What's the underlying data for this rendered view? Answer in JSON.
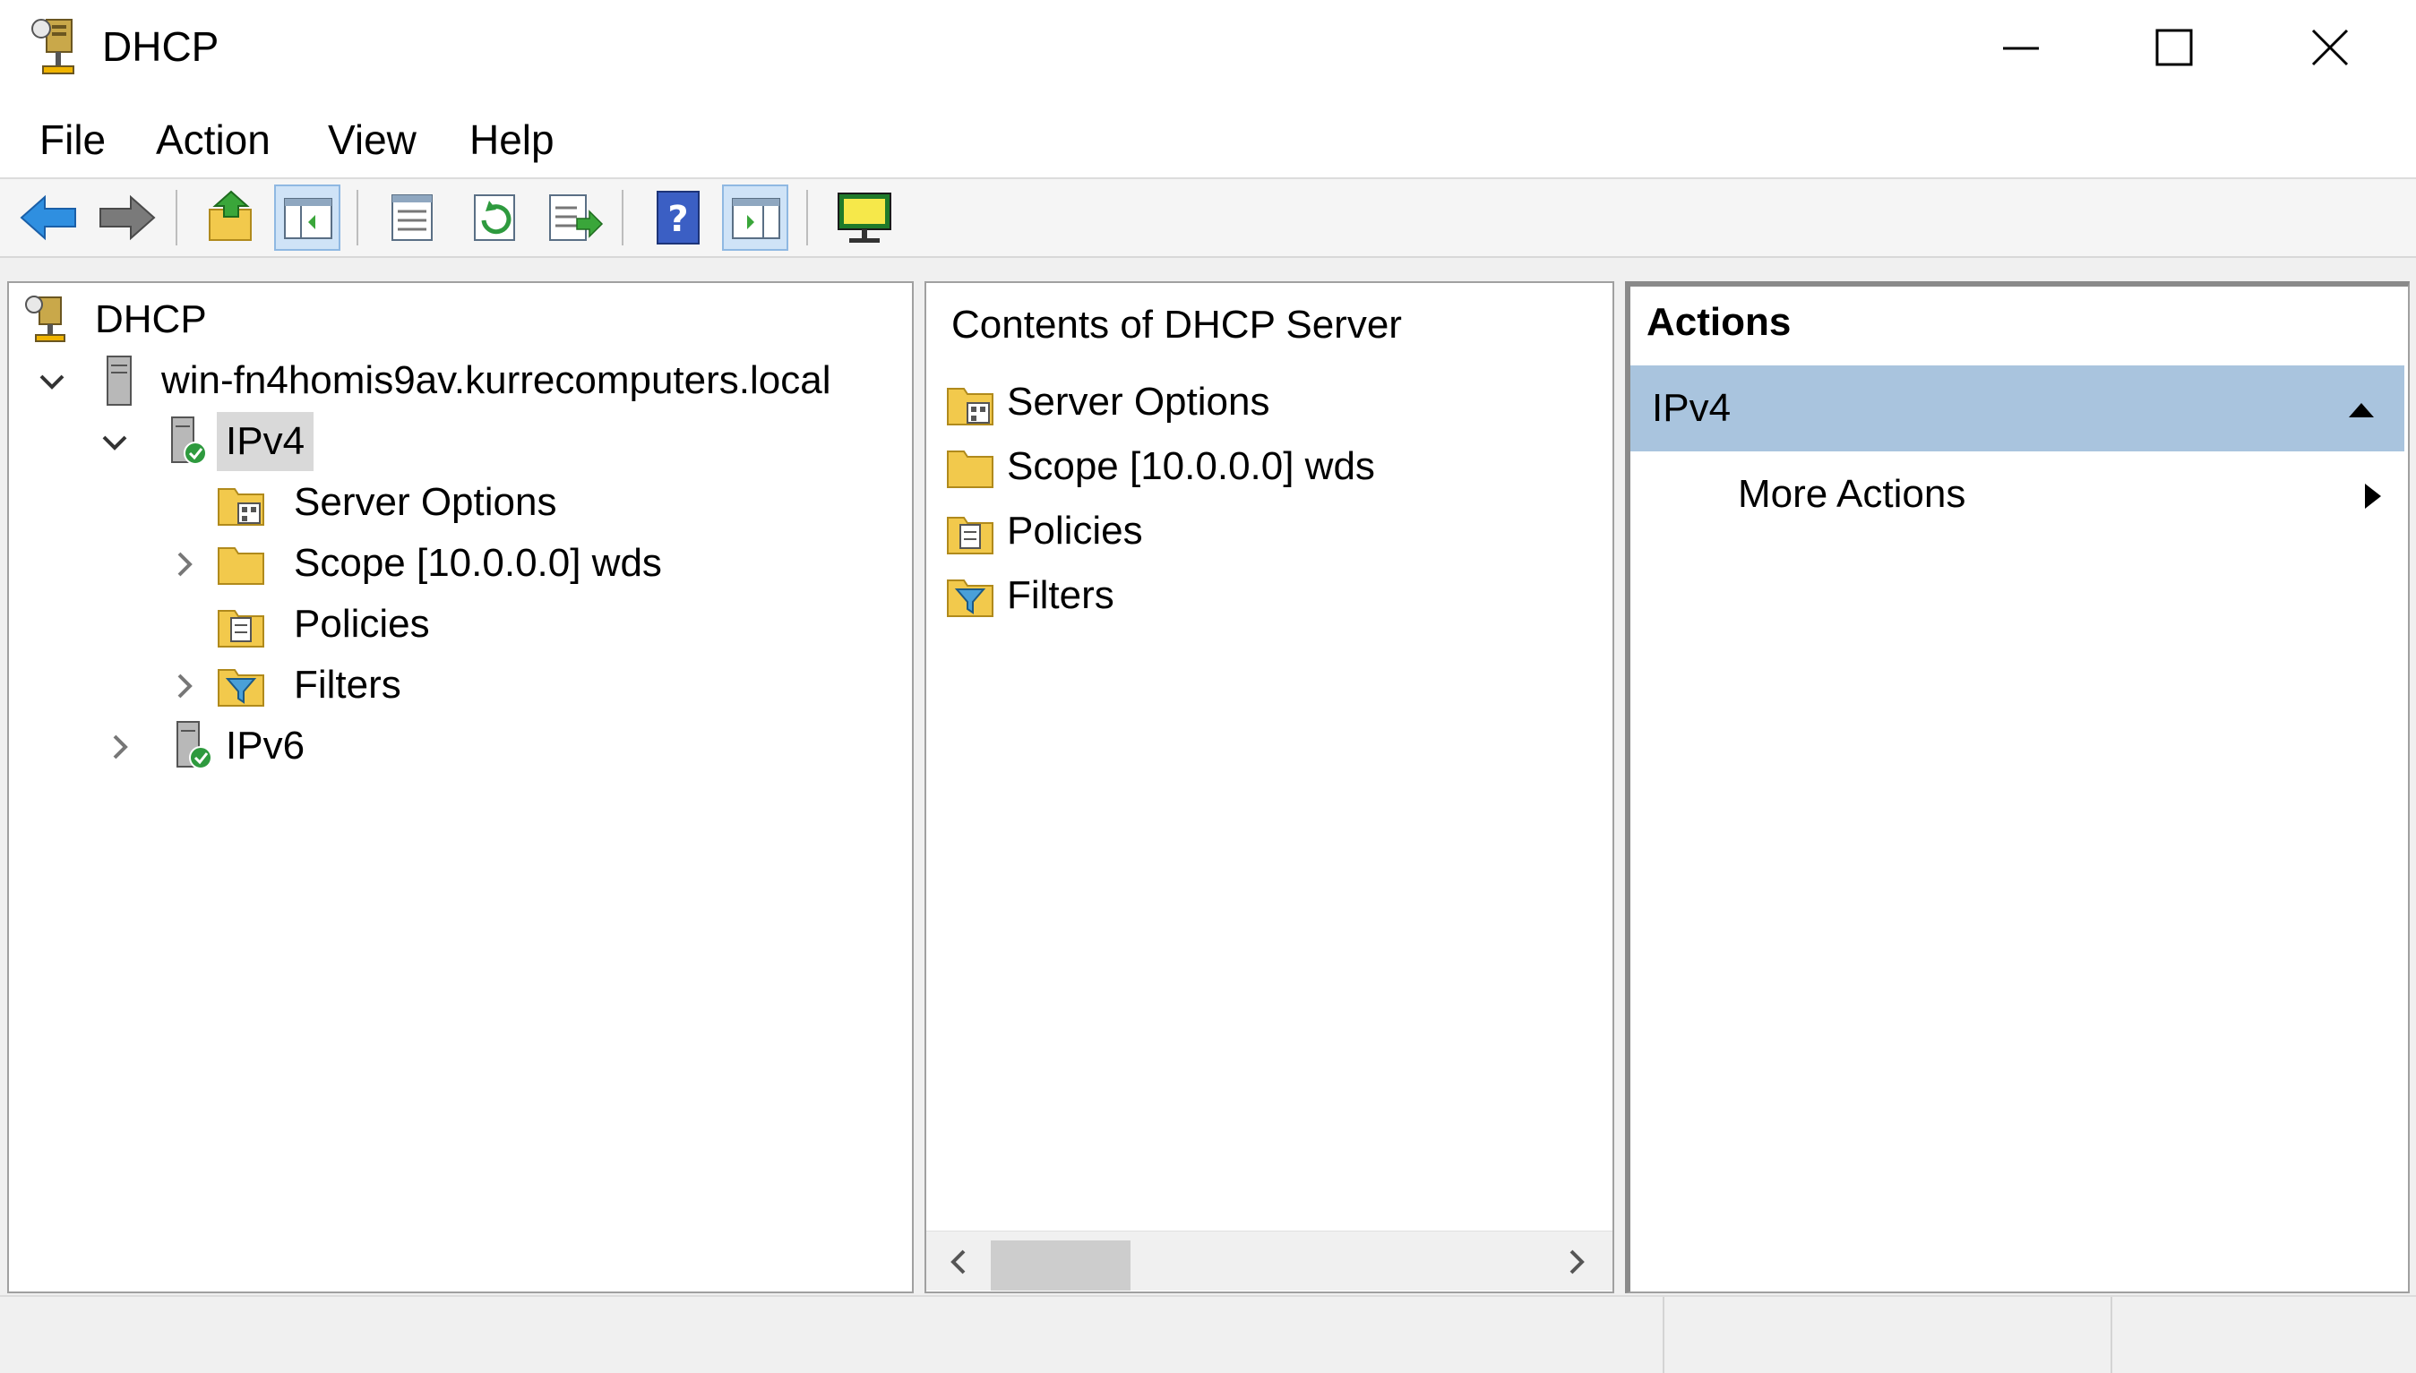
{
  "window": {
    "title": "DHCP"
  },
  "menu": {
    "items": [
      "File",
      "Action",
      "View",
      "Help"
    ]
  },
  "toolbar": {
    "buttons": [
      {
        "icon": "back-arrow-icon"
      },
      {
        "icon": "forward-arrow-icon"
      },
      {
        "icon": "up-one-level-icon"
      },
      {
        "icon": "show-hide-console-tree-icon",
        "pressed": true
      },
      {
        "icon": "properties-icon"
      },
      {
        "icon": "refresh-icon"
      },
      {
        "icon": "export-list-icon"
      },
      {
        "icon": "help-icon"
      },
      {
        "icon": "show-hide-action-pane-icon",
        "pressed": true
      },
      {
        "icon": "connect-to-computer-icon"
      }
    ]
  },
  "tree": {
    "root": "DHCP",
    "server": "win-fn4homis9av.kurrecomputers.local",
    "ipv4": "IPv4",
    "ipv4_children": [
      "Server Options",
      "Scope [10.0.0.0] wds",
      "Policies",
      "Filters"
    ],
    "ipv6": "IPv6"
  },
  "content": {
    "header": "Contents of DHCP Server",
    "items": [
      "Server Options",
      "Scope [10.0.0.0] wds",
      "Policies",
      "Filters"
    ]
  },
  "actions": {
    "header": "Actions",
    "section": "IPv4",
    "more_actions": "More Actions"
  },
  "colors": {
    "selection": "#d9d9d9",
    "actions_section_bg": "#a9c4de",
    "toolbar_pressed": "#cfe3f7"
  }
}
